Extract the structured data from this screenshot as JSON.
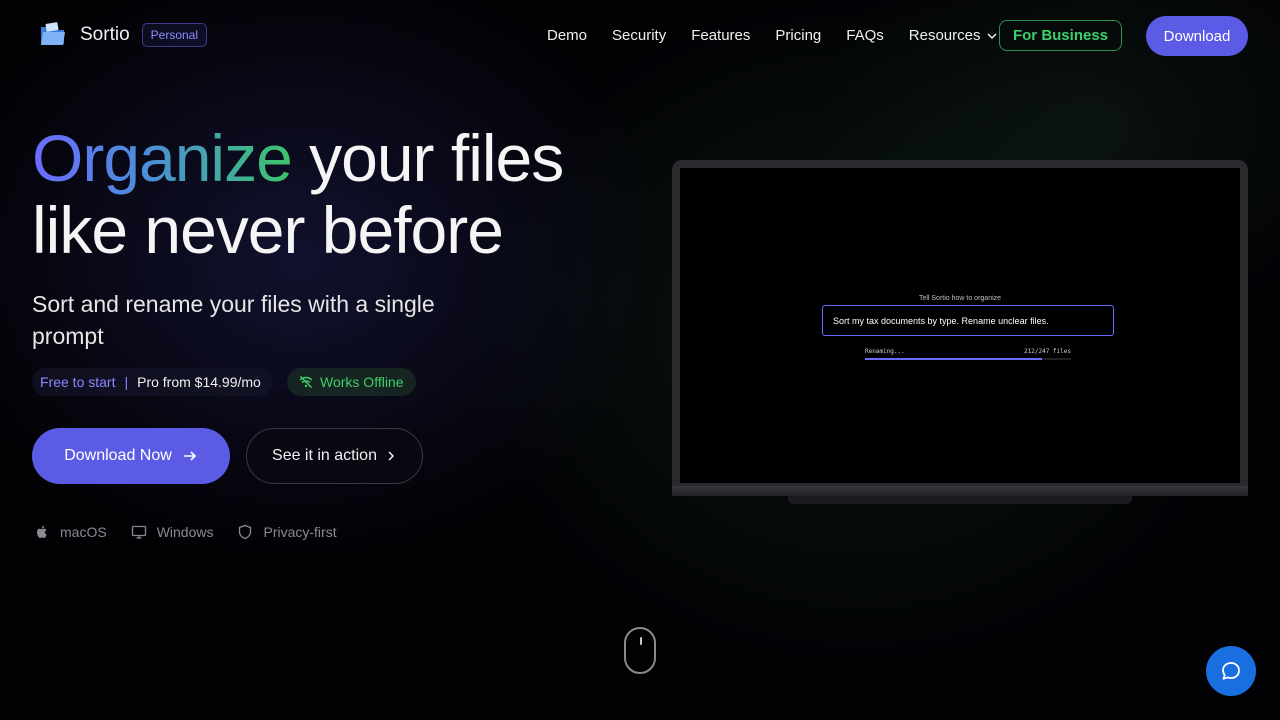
{
  "brand": {
    "name": "Sortio",
    "badge": "Personal"
  },
  "nav": {
    "links": [
      "Demo",
      "Security",
      "Features",
      "Pricing",
      "FAQs"
    ],
    "resources": "Resources",
    "business_label": "For Business",
    "download_label": "Download"
  },
  "hero": {
    "headline_highlight": "Organize",
    "headline_rest": " your files",
    "headline_line2": "like never before",
    "subheadline": "Sort and rename your files with a single prompt",
    "free_label": "Free to start",
    "separator": "|",
    "pro_label": "Pro from $14.99/mo",
    "offline_label": "Works Offline",
    "primary_cta": "Download Now",
    "secondary_cta": "See it in action",
    "platforms": [
      "macOS",
      "Windows",
      "Privacy-first"
    ]
  },
  "demo": {
    "prompt_label": "Tell Sortio how to organize",
    "prompt_text": "Sort my tax documents by type. Rename unclear files.",
    "status_text": "Renaming...",
    "count_text": "212/247 files",
    "progress": 0.86
  },
  "colors": {
    "accent": "#5b5be6",
    "business_green": "#3ecf6a",
    "chat_blue": "#1a6fe0"
  },
  "icons": {
    "logo": "folder-logo-icon",
    "resources_caret": "chevron-down-icon",
    "offline": "wifi-off-icon",
    "primary_cta": "arrow-right-icon",
    "secondary_cta": "chevron-right-icon",
    "platforms": [
      "apple-icon",
      "monitor-icon",
      "shield-icon"
    ],
    "scroll": "mouse-icon",
    "chat": "chat-bubble-icon"
  }
}
